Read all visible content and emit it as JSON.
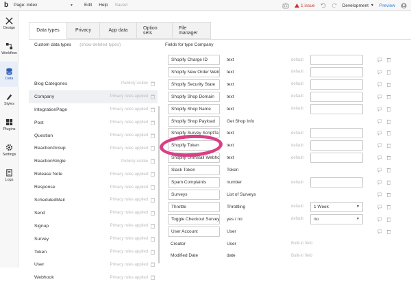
{
  "topbar": {
    "logo": "b",
    "page_label": "Page: index",
    "menu": [
      "Edit",
      "Help"
    ],
    "saved": "Saved",
    "issues": "1 issue",
    "environment": "Development",
    "preview": "Preview"
  },
  "sidebar": {
    "items": [
      {
        "label": "Design",
        "icon": "design-icon"
      },
      {
        "label": "Workflow",
        "icon": "workflow-icon"
      },
      {
        "label": "Data",
        "icon": "database-icon",
        "active": true
      },
      {
        "label": "Styles",
        "icon": "styles-icon"
      },
      {
        "label": "Plugins",
        "icon": "plugins-icon"
      },
      {
        "label": "Settings",
        "icon": "gear-icon"
      },
      {
        "label": "Logs",
        "icon": "logs-icon"
      }
    ]
  },
  "tabs": [
    "Data types",
    "Privacy",
    "App data",
    "Option sets",
    "File manager"
  ],
  "left": {
    "header": "Custom data types",
    "show_deleted": "(show deleted types)",
    "types": [
      {
        "name": "Blog Categories",
        "privacy": "Publicly visible"
      },
      {
        "name": "Company",
        "privacy": "Privacy rules applied",
        "active": true
      },
      {
        "name": "IntegrationPage",
        "privacy": "Privacy rules applied"
      },
      {
        "name": "Post",
        "privacy": "Privacy rules applied"
      },
      {
        "name": "Question",
        "privacy": "Privacy rules applied"
      },
      {
        "name": "ReactionGroup",
        "privacy": "Privacy rules applied"
      },
      {
        "name": "ReactionSingle",
        "privacy": "Publicly visible"
      },
      {
        "name": "Release Note",
        "privacy": "Privacy rules applied"
      },
      {
        "name": "Response",
        "privacy": "Privacy rules applied"
      },
      {
        "name": "ScheduledMail",
        "privacy": "Privacy rules applied"
      },
      {
        "name": "Send",
        "privacy": "Privacy rules applied"
      },
      {
        "name": "Signup",
        "privacy": "Privacy rules applied"
      },
      {
        "name": "Survey",
        "privacy": "Privacy rules applied"
      },
      {
        "name": "Token",
        "privacy": "Privacy rules applied"
      },
      {
        "name": "User",
        "privacy": "Privacy rules applied"
      },
      {
        "name": "Webhook",
        "privacy": "Privacy rules applied"
      }
    ]
  },
  "right": {
    "header": "Fields for type Company",
    "fields": [
      {
        "name": "Shopify Charge ID",
        "type": "text",
        "default_label": "default",
        "default_value": ""
      },
      {
        "name": "Shopify New Order Web",
        "type": "text",
        "default_label": "default",
        "default_value": ""
      },
      {
        "name": "Shopify Security State",
        "type": "text",
        "default_label": "default",
        "default_value": ""
      },
      {
        "name": "Shopify Shop Domain",
        "type": "text",
        "default_label": "default",
        "default_value": ""
      },
      {
        "name": "Shopify Shop Name",
        "type": "text",
        "default_label": "default",
        "default_value": ""
      },
      {
        "name": "Shopify Shop Payload",
        "type": "Get Shop Info"
      },
      {
        "name": "Shopify Survey ScriptTa",
        "type": "text",
        "default_label": "default",
        "default_value": ""
      },
      {
        "name": "Shopify Token",
        "type": "text",
        "default_label": "default",
        "default_value": ""
      },
      {
        "name": "Shopify Uninstall Webho",
        "type": "text",
        "default_label": "default",
        "default_value": ""
      },
      {
        "name": "Slack Token",
        "type": "Token"
      },
      {
        "name": "Spam Complaints",
        "type": "number",
        "default_label": "default",
        "default_value": ""
      },
      {
        "name": "Surveys",
        "type": "List of Surveys"
      },
      {
        "name": "Throttle",
        "type": "Throttling",
        "default_label": "default",
        "default_value": "1 Week",
        "dropdown": true
      },
      {
        "name": "Toggle Checkout Survey",
        "type": "yes / no",
        "default_label": "default",
        "default_value": "no",
        "dropdown": true
      },
      {
        "name": "User Account",
        "type": "User"
      },
      {
        "name": "Creator",
        "type": "User",
        "builtin": "Built-in field"
      },
      {
        "name": "Modified Date",
        "type": "date",
        "builtin": "Built-in field"
      }
    ]
  },
  "colors": {
    "highlight_circle": "#d93f86",
    "issue": "#d03030",
    "link": "#2b7fd6"
  }
}
